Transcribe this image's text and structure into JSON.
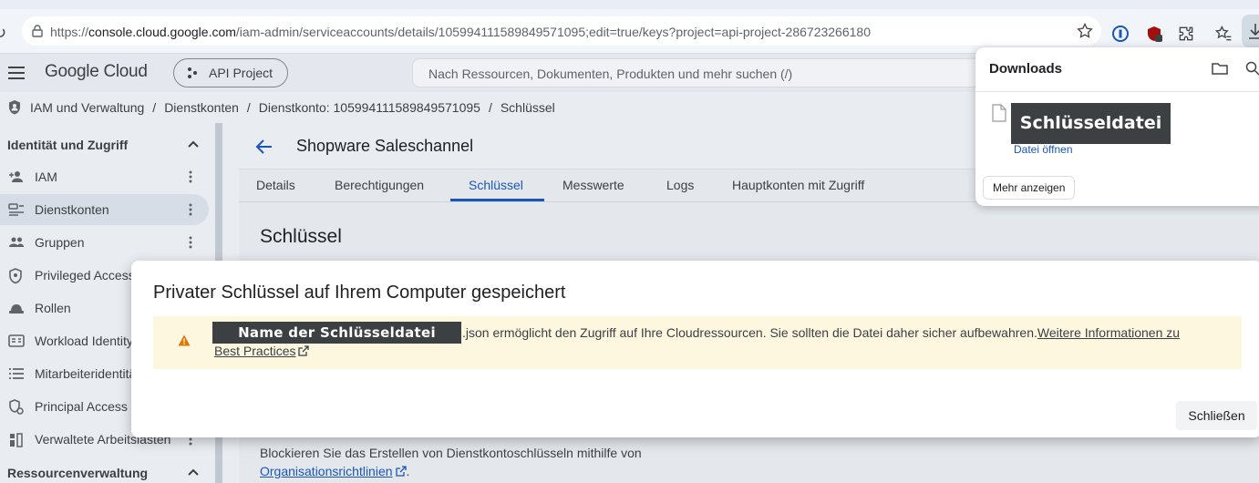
{
  "browser": {
    "url_scheme": "https://",
    "url_host": "console.cloud.google.com",
    "url_path": "/iam-admin/serviceaccounts/details/105994111589849571095;edit=true/keys?project=api-project-286723266180"
  },
  "console": {
    "logo": "Google Cloud",
    "project": "API Project",
    "search_placeholder": "Nach Ressourcen, Dokumenten, Produkten und mehr suchen (/)"
  },
  "breadcrumb": [
    "IAM und Verwaltung",
    "Dienstkonten",
    "Dienstkonto: 105994111589849571095",
    "Schlüssel"
  ],
  "sidebar": {
    "section1": "Identität und Zugriff",
    "items": [
      {
        "label": "IAM",
        "icon": "person-add-icon"
      },
      {
        "label": "Dienstkonten",
        "icon": "service-account-icon"
      },
      {
        "label": "Gruppen",
        "icon": "groups-icon"
      },
      {
        "label": "Privileged Access Manager",
        "icon": "shield-icon"
      },
      {
        "label": "Rollen",
        "icon": "roles-icon"
      },
      {
        "label": "Workload Identity-Föderation",
        "icon": "badge-icon"
      },
      {
        "label": "Mitarbeiteridentitäts-Föderation",
        "icon": "list-icon"
      },
      {
        "label": "Principal Access Boundary",
        "icon": "principal-icon"
      },
      {
        "label": "Verwaltete Arbeitslasten",
        "icon": "workload-icon"
      }
    ],
    "section2": "Ressourcenverwaltung"
  },
  "main": {
    "title": "Shopware Saleschannel",
    "tabs": [
      "Details",
      "Berechtigungen",
      "Schlüssel",
      "Messwerte",
      "Logs",
      "Hauptkonten mit Zugriff"
    ],
    "active_tab": "Schlüssel",
    "section_title": "Schlüssel",
    "footer_line1": "Blockieren Sie das Erstellen von Dienstkontoschlüsseln mithilfe von",
    "footer_link": "Organisationsrichtlinien",
    "footer_end": "."
  },
  "modal": {
    "title": "Privater Schlüssel auf Ihrem Computer gespeichert",
    "redacted_name": "Name der Schlüsseldatei",
    "message": ".json ermöglicht den Zugriff auf Ihre Cloudressourcen. Sie sollten die Datei daher sicher aufbewahren.",
    "link_part1": "Weitere Informationen zu",
    "link_part2": "Best Practices",
    "close_button": "Schließen"
  },
  "downloads": {
    "title": "Downloads",
    "file_name": "Schlüsseldatei",
    "open_file": "Datei öffnen",
    "show_more": "Mehr anzeigen"
  },
  "colors": {
    "accent": "#1a56b8",
    "warning_bg": "#fef7e0",
    "warning_icon": "#e37400",
    "redaction": "#3c4043"
  }
}
